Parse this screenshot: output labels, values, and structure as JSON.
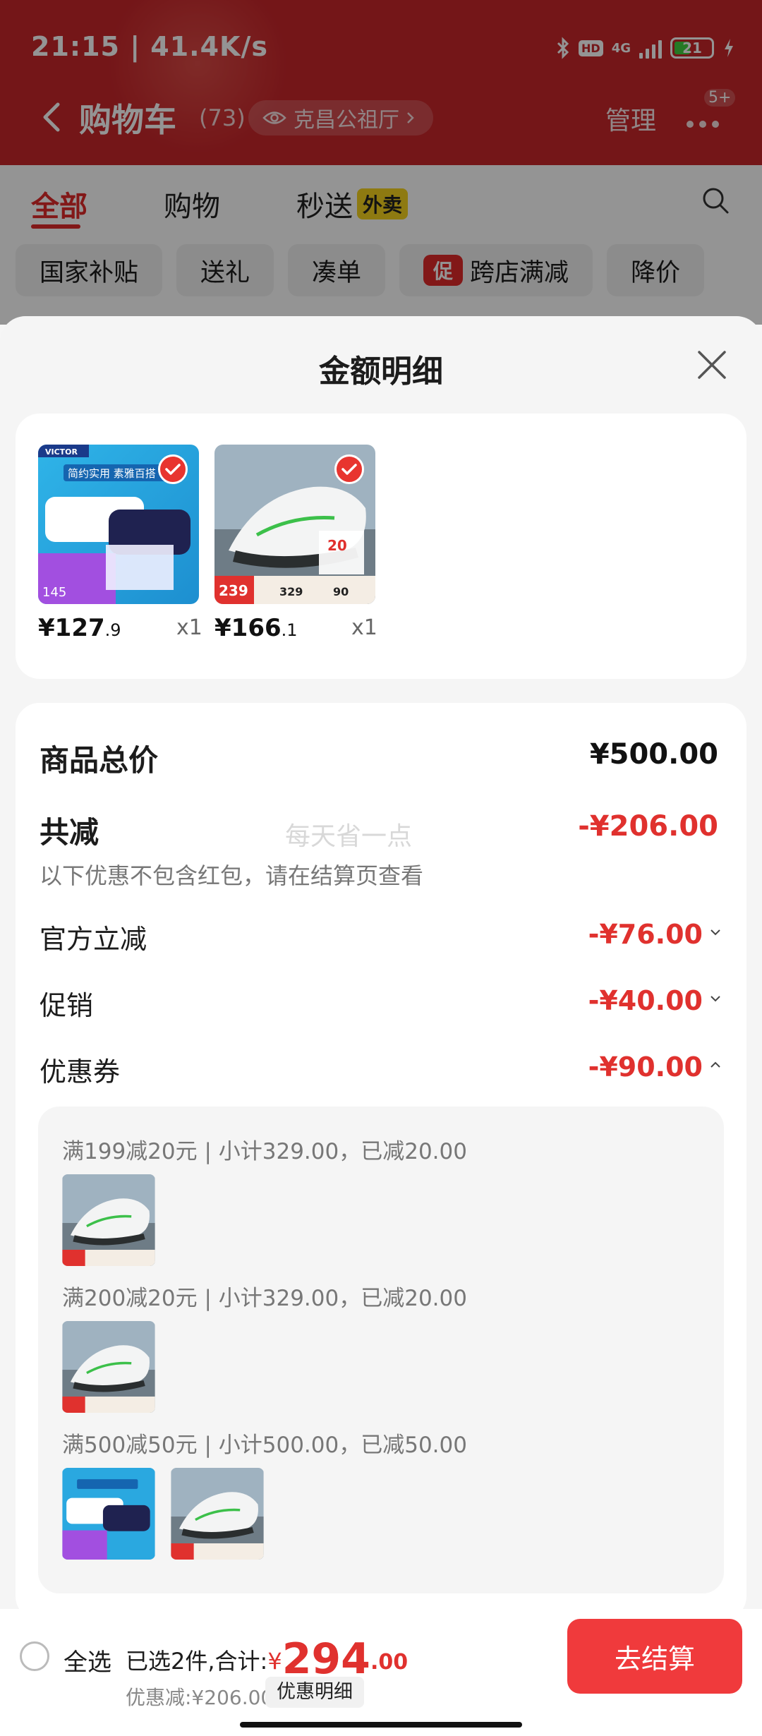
{
  "status_bar": {
    "time": "21:15 | 41.4K/s",
    "network": "4G",
    "hd": "HD",
    "battery": "21"
  },
  "nav": {
    "title": "购物车",
    "count": "(73)",
    "location": "克昌公祖厅",
    "manage": "管理",
    "more_badge": "5+"
  },
  "tabs": [
    {
      "label": "全部",
      "active": true
    },
    {
      "label": "购物"
    },
    {
      "label": "秒送",
      "tag": "外卖"
    }
  ],
  "chips": [
    {
      "label": "国家补贴"
    },
    {
      "label": "送礼"
    },
    {
      "label": "凑单"
    },
    {
      "label": "跨店满减",
      "badge": "促"
    },
    {
      "label": "降价"
    }
  ],
  "sheet": {
    "title": "金额明细",
    "products": [
      {
        "name": "羽毛球包",
        "price_int": "¥127",
        "price_dec": ".9",
        "qty": "x1",
        "selected": true,
        "img_texts": {
          "brand": "VICTOR",
          "slogan": "简约实用 素雅百搭",
          "price": "145"
        }
      },
      {
        "name": "运动鞋",
        "price_int": "¥166",
        "price_dec": ".1",
        "qty": "x1",
        "selected": true,
        "img_texts": {
          "price_a": "239",
          "price_b": "329",
          "price_c": "90",
          "tag": "20"
        }
      }
    ],
    "summary": {
      "total_label": "商品总价",
      "total_value": "¥500.00",
      "reduce_label": "共减",
      "reduce_value": "-¥206.00",
      "note": "以下优惠不包含红包，请在结算页查看",
      "watermark": "每天省一点",
      "rows": [
        {
          "label": "官方立减",
          "value": "-¥76.00",
          "expanded": false
        },
        {
          "label": "促销",
          "value": "-¥40.00",
          "expanded": false
        },
        {
          "label": "优惠券",
          "value": "-¥90.00",
          "expanded": true
        }
      ]
    },
    "coupons": [
      {
        "line": "满199减20元 | 小计329.00，已减20.00"
      },
      {
        "line": "满200减20元 | 小计329.00，已减20.00"
      },
      {
        "line": "满500减50元 | 小计500.00，已减50.00"
      }
    ]
  },
  "bottom_bar": {
    "select_all": "全选",
    "selected_text": "已选2件,合计:",
    "yen": "¥",
    "total_int": "294",
    "total_dec": ".00",
    "discount_text": "优惠减:¥206.00",
    "detail_button": "优惠明细",
    "checkout_button": "去结算"
  },
  "colors": {
    "header_red": "#c8262a",
    "accent_red": "#e0312e",
    "checkout_red": "#f03a3c"
  }
}
